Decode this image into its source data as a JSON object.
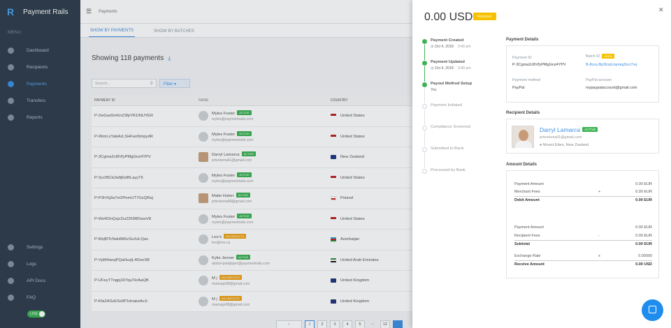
{
  "app": {
    "name": "Payment Rails",
    "menu_title": "MENU",
    "live_label": "LIVE"
  },
  "sidebar": {
    "items": [
      {
        "label": "Dashboard",
        "icon": "dashboard-icon"
      },
      {
        "label": "Recipients",
        "icon": "recipients-icon"
      },
      {
        "label": "Payments",
        "icon": "payments-icon",
        "active": true
      },
      {
        "label": "Transfers",
        "icon": "transfers-icon"
      },
      {
        "label": "Reports",
        "icon": "reports-icon"
      }
    ],
    "bottom": [
      {
        "label": "Settings",
        "icon": "gear-icon"
      },
      {
        "label": "Logs",
        "icon": "history-icon"
      },
      {
        "label": "API Docs",
        "icon": "book-icon"
      },
      {
        "label": "FAQ",
        "icon": "help-icon"
      }
    ]
  },
  "header": {
    "breadcrumb": "Payments"
  },
  "tabs": [
    "SHOW BY PAYMENTS",
    "SHOW BY BATCHES"
  ],
  "list": {
    "heading": "Showing 118 payments",
    "search_placeholder": "Search...",
    "filter_label": "Filter",
    "columns": [
      "PAYMENT ID",
      "NAME",
      "COUNTRY"
    ],
    "rows": [
      {
        "id": "P-2wGao5mKnZ3fpYR1INUYER",
        "name": "Myles Foster",
        "status": "ACTIVE",
        "email": "myles@paymentrails.com",
        "country": "United States"
      },
      {
        "id": "P-WimLxYabAzLSHFanNmpydR",
        "name": "Myles Foster",
        "status": "ACTIVE",
        "email": "myles@paymentrails.com",
        "country": "United States"
      },
      {
        "id": "P-3Cgma2c8iVfyPMgGnz4YPV",
        "name": "Darryl Lamarca",
        "status": "ACTIVE",
        "email": "prtestemail1@gmail.com",
        "country": "New Zealand"
      },
      {
        "id": "P-Sccf9CbJw9j6stBLayyT5",
        "name": "Myles Foster",
        "status": "ACTIVE",
        "email": "myles@paymentrails.com",
        "country": "United States"
      },
      {
        "id": "P-P3hYq3a7m2PemUT7GxQRaj",
        "name": "Maite Huber",
        "status": "ACTIVE",
        "email": "prtestemail8@gmail.com",
        "country": "Poland"
      },
      {
        "id": "P-WoRDnQxjcDu2259f8SwoV8",
        "name": "Myles Foster",
        "status": "ACTIVE",
        "email": "myles@paymentrails.com",
        "country": "United States"
      },
      {
        "id": "P-Msjf0TcNah8A6zSuXsLQax",
        "name": "Lee k",
        "status": "INCOMPLETE",
        "email": "lee@me.ca",
        "country": "Azerbaijan"
      },
      {
        "id": "P-VpM4aoqPQaHusjL4f2seSB",
        "name": "Kylie Jenner",
        "status": "ACTIVE",
        "email": "abdul+piedpiper@paymentrails.com",
        "country": "United Arab Emirates"
      },
      {
        "id": "P-UFeyTTngpj16YquTkrAaQB",
        "name": "M j",
        "status": "INCOMPLETE",
        "email": "marisajo08@gmail.com",
        "country": "United Kingdom"
      },
      {
        "id": "P-Kfa2ASzESs9P1dnaksAvJr",
        "name": "M j",
        "status": "INCOMPLETE",
        "email": "marisajo08@gmail.com",
        "country": "United Kingdom"
      }
    ],
    "pages": [
      "1",
      "2",
      "3",
      "4",
      "5",
      "...",
      "12"
    ]
  },
  "detail": {
    "amount": "0.00 USD",
    "status": "PENDING",
    "timeline": [
      {
        "label": "Payment Created",
        "date": "Oct 4, 2018",
        "time": "3:40 pm",
        "done": true
      },
      {
        "label": "Payment Updated",
        "date": "Oct 4, 2018",
        "time": "3:40 pm",
        "done": true
      },
      {
        "label": "Payout Method Setup",
        "note": "Yes",
        "done": true
      },
      {
        "label": "Payment Initiated",
        "done": false
      },
      {
        "label": "Compliance Screened",
        "done": false
      },
      {
        "label": "Submitted to Bank",
        "done": false
      },
      {
        "label": "Processed by Bank",
        "done": false
      }
    ],
    "payment_details": {
      "title": "Payment Details",
      "payment_id_label": "Payment ID",
      "payment_id": "P-3Cgma2c8iVfyPMgGnz4YPV",
      "batch_id_label": "Batch ID",
      "batch_status": "OPEN",
      "batch_id": "B-8ceyJfp2ExpUamegSnz7oq",
      "method_label": "Payment method",
      "method": "PayPal",
      "account_label": "PayPal account",
      "account": "mypaypalaccount@gmail.com"
    },
    "recipient": {
      "title": "Recipient Details",
      "name": "Darryl Lamarca",
      "status": "ACTIVE",
      "email": "prtestemail1@gmail.com",
      "location": "Mount Eden, New Zealand"
    },
    "amounts": {
      "title": "Amount Details",
      "rows": [
        {
          "label": "Payment Amount",
          "sign": "",
          "value": "0.00 EUR"
        },
        {
          "label": "Merchant Fees",
          "sign": "+",
          "value": "0.00 EUR"
        },
        {
          "label": "Debit Amount",
          "sign": "",
          "value": "0.00 EUR"
        },
        {
          "label": "Payment Amount",
          "sign": "",
          "value": "0.00 EUR"
        },
        {
          "label": "Recipient Fees",
          "sign": "-",
          "value": "0.00 EUR"
        },
        {
          "label": "Subtotal",
          "sign": "",
          "value": "0.00 EUR"
        },
        {
          "label": "Exchange Rate",
          "sign": "x",
          "value": "0.00000"
        },
        {
          "label": "Receive Amount",
          "sign": "",
          "value": "0.00 USD"
        }
      ]
    }
  },
  "colors": {
    "accent": "#3e8fe3",
    "active": "#3db354",
    "incomplete": "#f0a51a",
    "pending": "#f6c100",
    "sidebar": "#2f3e4d"
  }
}
